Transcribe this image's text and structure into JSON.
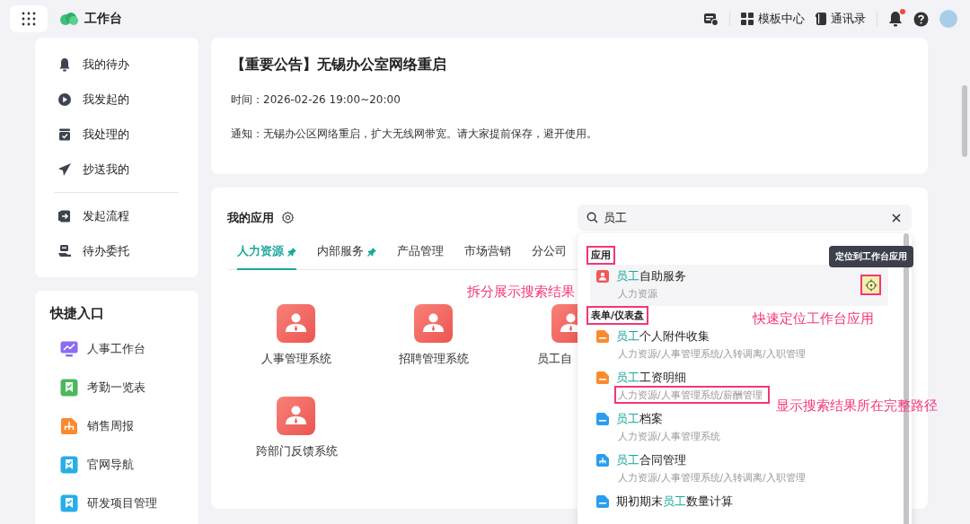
{
  "topbar": {
    "title": "工作台",
    "links": [
      {
        "label": "模板中心"
      },
      {
        "label": "通讯录"
      }
    ],
    "notification": true
  },
  "nav_groups": [
    [
      {
        "label": "我的待办"
      },
      {
        "label": "我发起的"
      },
      {
        "label": "我处理的"
      },
      {
        "label": "抄送我的"
      }
    ],
    [
      {
        "label": "发起流程"
      },
      {
        "label": "待办委托"
      }
    ]
  ],
  "shortcuts": {
    "title": "快捷入口",
    "items": [
      {
        "label": "人事工作台",
        "color": "#8b6cf0"
      },
      {
        "label": "考勤一览表",
        "color": "#4cb85c"
      },
      {
        "label": "销售周报",
        "color": "#fb8a2e"
      },
      {
        "label": "官网导航",
        "color": "#27aee6"
      },
      {
        "label": "研发项目管理",
        "color": "#27aee6"
      }
    ]
  },
  "notice": {
    "title": "【重要公告】无锡办公室网络重启",
    "time": "时间：2026-02-26 19:00~20:00",
    "body": "通知：无锡办公区网络重启，扩大无线网带宽。请大家提前保存，避开使用。"
  },
  "apps": {
    "title": "我的应用",
    "tabs": [
      {
        "label": "人力资源",
        "selected": true,
        "pinned": true
      },
      {
        "label": "内部服务",
        "selected": false,
        "pinned": true
      },
      {
        "label": "产品管理",
        "selected": false,
        "pinned": false
      },
      {
        "label": "市场营销",
        "selected": false,
        "pinned": false
      },
      {
        "label": "分公司",
        "selected": false,
        "pinned": false
      }
    ],
    "items": [
      {
        "label": "人事管理系统"
      },
      {
        "label": "招聘管理系统"
      },
      {
        "label": "员工自"
      },
      {
        "label": "跨部门反馈系统"
      }
    ]
  },
  "search": {
    "value": "员工",
    "note": "拆分展示搜索结果",
    "sections": [
      {
        "title": "应用",
        "boxed": true,
        "items": [
          {
            "kind": "app",
            "color": "#f0585a",
            "title": "**员工**自助服务",
            "path": "人力资源",
            "hovered": true,
            "path_boxed": false,
            "locate": {
              "tooltip": "定位到工作台应用",
              "boxed": true,
              "note": "快速定位工作台应用"
            }
          }
        ]
      },
      {
        "title": "表单/仪表盘",
        "boxed": true,
        "items": [
          {
            "kind": "form",
            "color": "#fb8a2e",
            "title": "**员工**个人附件收集",
            "path": "人力资源/人事管理系统/入转调离/入职管理",
            "hovered": false,
            "path_boxed": false
          },
          {
            "kind": "form",
            "color": "#fb8a2e",
            "title": "**员工**工资明细",
            "path": "人力资源/人事管理系统/薪酬管理",
            "hovered": false,
            "path_boxed": true,
            "path_note": "显示搜索结果所在完整路径"
          },
          {
            "kind": "form",
            "color": "#2a9df0",
            "title": "**员工**档案",
            "path": "人力资源/人事管理系统",
            "hovered": false,
            "path_boxed": false
          },
          {
            "kind": "dashboard",
            "color": "#2a9df0",
            "title": "**员工**合同管理",
            "path": "人力资源/人事管理系统/入转调离/入职管理",
            "hovered": false,
            "path_boxed": false
          },
          {
            "kind": "form",
            "color": "#2a9df0",
            "title": "期初期末**员工**数量计算",
            "hovered": false
          }
        ]
      }
    ]
  }
}
